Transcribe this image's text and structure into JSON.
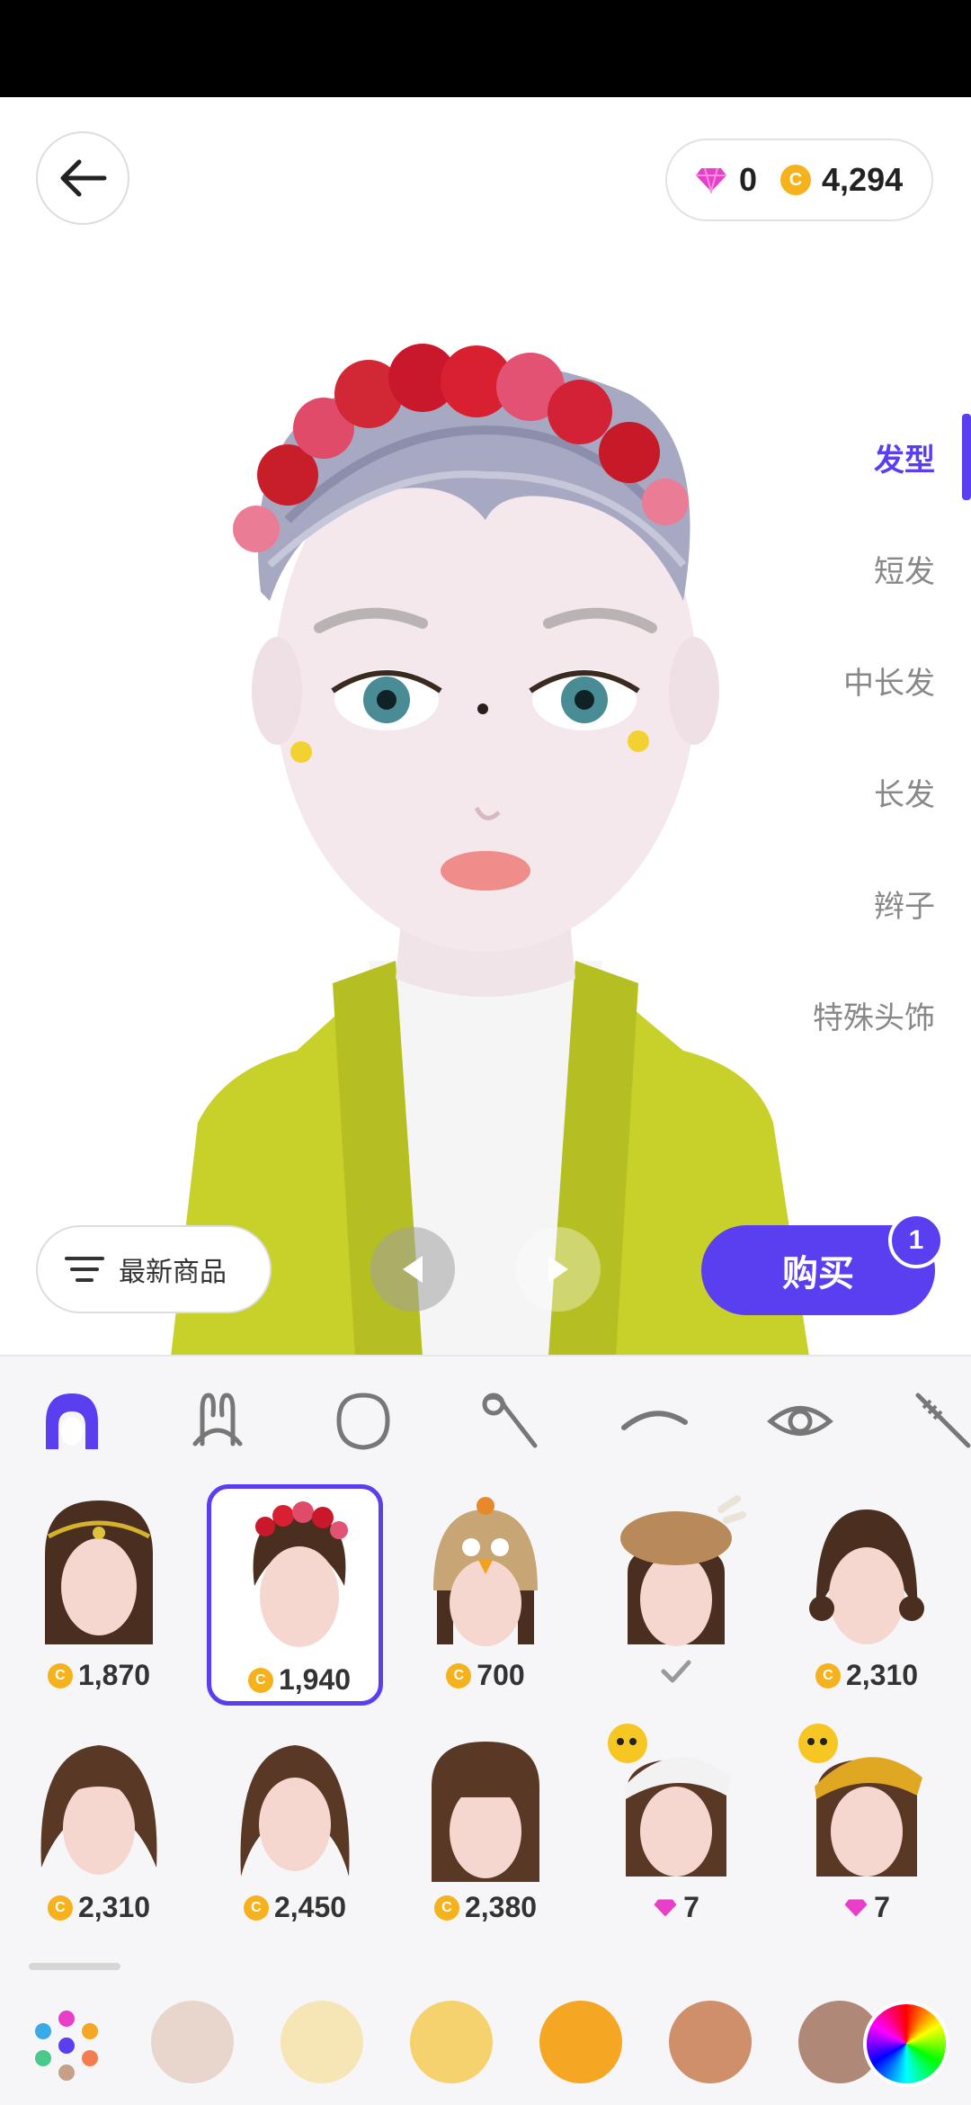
{
  "header": {
    "gems": "0",
    "coins": "4,294"
  },
  "categories": [
    {
      "label": "发型",
      "active": true
    },
    {
      "label": "短发",
      "active": false
    },
    {
      "label": "中长发",
      "active": false
    },
    {
      "label": "长发",
      "active": false
    },
    {
      "label": "辫子",
      "active": false
    },
    {
      "label": "特殊头饰",
      "active": false
    }
  ],
  "controls": {
    "filter_label": "最新商品",
    "buy_label": "购买",
    "buy_count": "1"
  },
  "tabs": [
    {
      "icon": "hair-icon",
      "active": true
    },
    {
      "icon": "bunny-ears-icon",
      "active": false
    },
    {
      "icon": "face-shape-icon",
      "active": false
    },
    {
      "icon": "makeup-brush-icon",
      "active": false
    },
    {
      "icon": "eyebrow-icon",
      "active": false
    },
    {
      "icon": "eye-icon",
      "active": false
    },
    {
      "icon": "mascara-icon",
      "active": false
    }
  ],
  "items": [
    {
      "price": "1,870",
      "currency": "coin",
      "selected": false
    },
    {
      "price": "1,940",
      "currency": "coin",
      "selected": true
    },
    {
      "price": "700",
      "currency": "coin",
      "selected": false
    },
    {
      "price": "",
      "currency": "owned",
      "selected": false
    },
    {
      "price": "2,310",
      "currency": "coin",
      "selected": false
    },
    {
      "price": "2,310",
      "currency": "coin",
      "selected": false
    },
    {
      "price": "2,450",
      "currency": "coin",
      "selected": false
    },
    {
      "price": "2,380",
      "currency": "coin",
      "selected": false
    },
    {
      "price": "7",
      "currency": "gem",
      "selected": false
    },
    {
      "price": "7",
      "currency": "gem",
      "selected": false
    }
  ],
  "swatches": [
    "#e8d6cc",
    "#f6e5b5",
    "#f5d26e",
    "#f5a623",
    "#cf8f6a",
    "#b08878"
  ],
  "colors": {
    "accent": "#5a3ff0",
    "coin": "#f6b21d",
    "gem": "#e83ec8"
  }
}
